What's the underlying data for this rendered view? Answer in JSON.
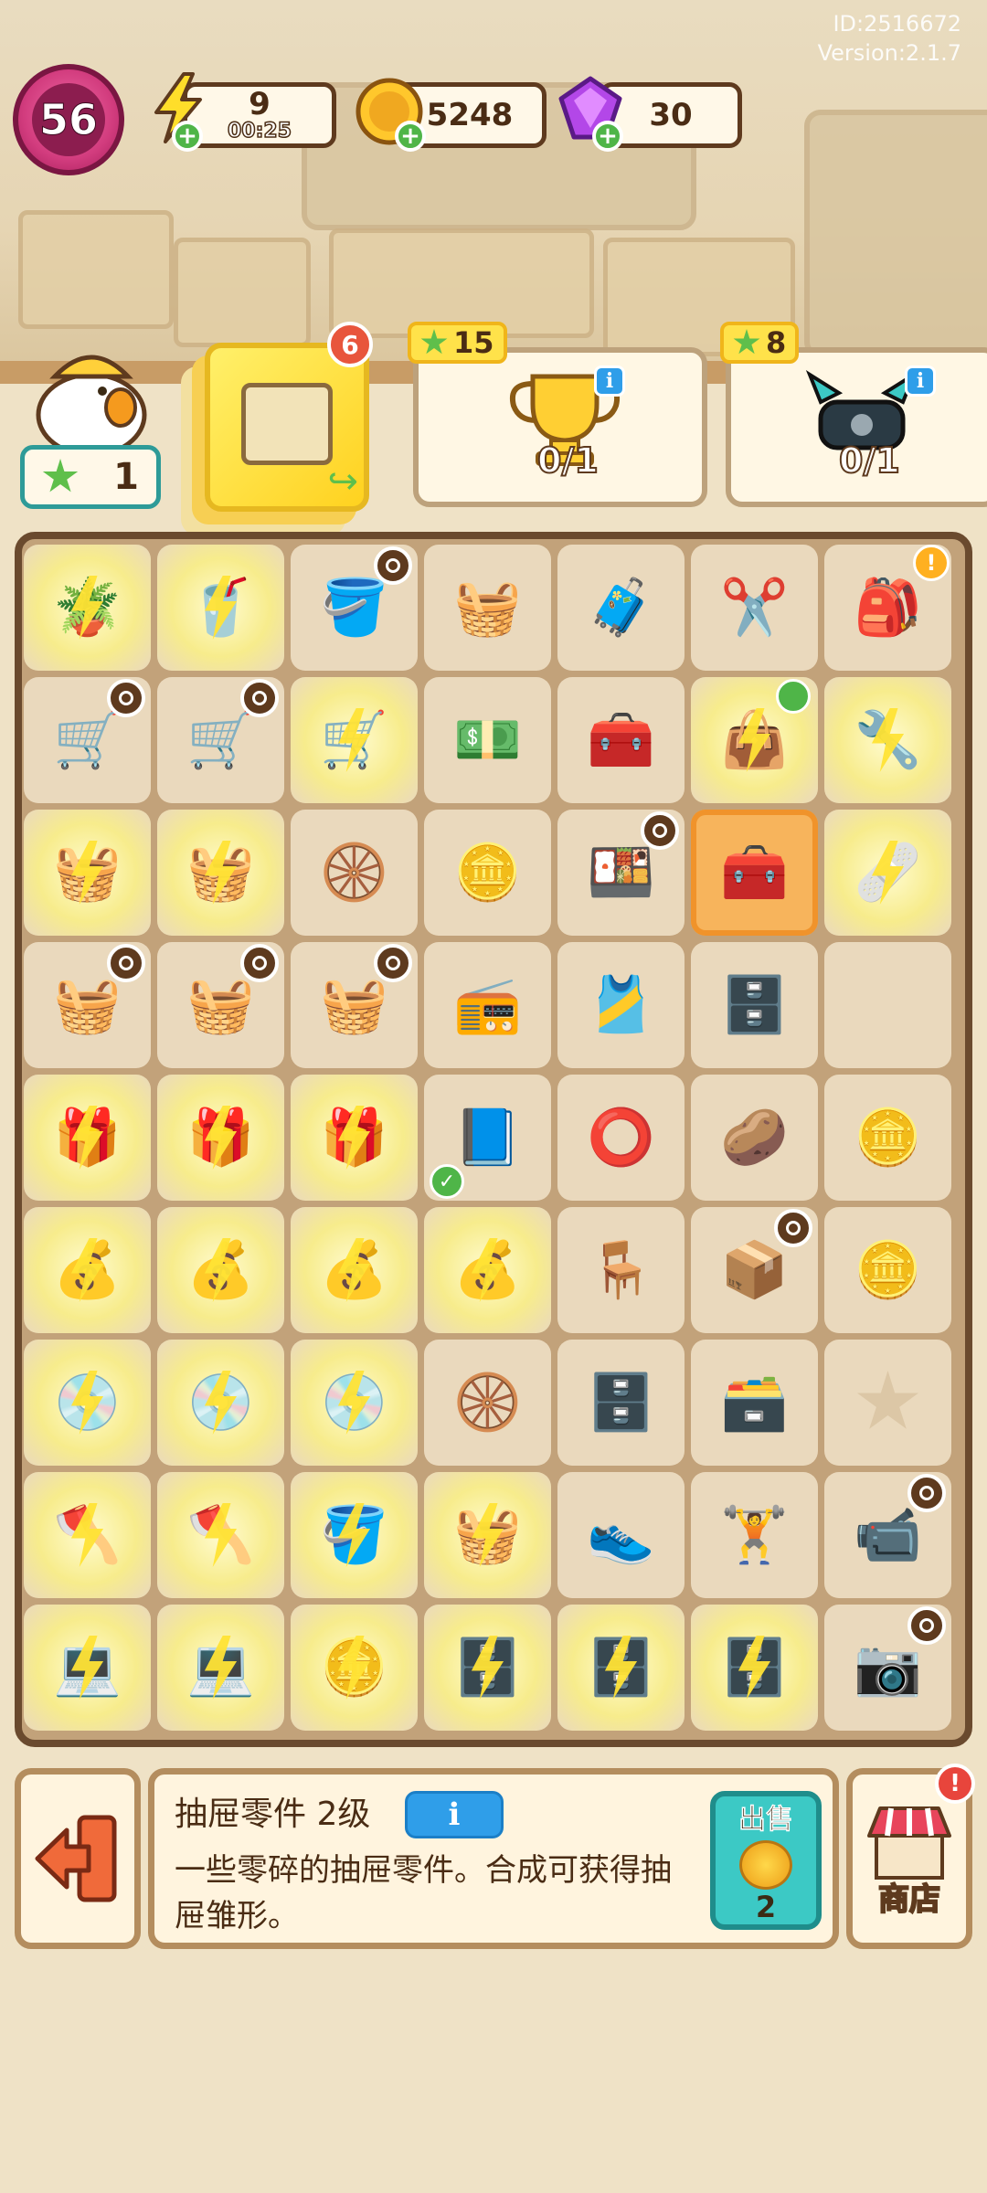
{
  "header": {
    "player_id": "ID:2516672",
    "version": "Version:2.1.7"
  },
  "resources": {
    "level": "56",
    "energy": {
      "value": "9",
      "timer": "00:25"
    },
    "coins": "5248",
    "gems": "30"
  },
  "quests": {
    "duck_stars": "1",
    "active_card_badge": "6",
    "trophy_reward": "15",
    "trophy_progress": "0/1",
    "robot_reward": "8",
    "robot_progress": "0/1"
  },
  "board": {
    "rows": [
      [
        {
          "item": "🪴",
          "glow": true
        },
        {
          "item": "🥤",
          "glow": true
        },
        {
          "item": "🪣",
          "clock": true
        },
        {
          "item": "🧺"
        },
        {
          "item": "🧳"
        },
        {
          "item": "✂️"
        },
        {
          "item": "🎒",
          "alert": true
        }
      ],
      [
        {
          "item": "🛒",
          "clock": true
        },
        {
          "item": "🛒",
          "clock": true
        },
        {
          "item": "🛒",
          "glow": true
        },
        {
          "item": "💵"
        },
        {
          "item": "🧰"
        },
        {
          "item": "👜",
          "glow": true,
          "lock": true
        },
        {
          "item": "🔧",
          "glow": true
        }
      ],
      [
        {
          "item": "🧺",
          "glow": true
        },
        {
          "item": "🧺",
          "glow": true
        },
        {
          "item": "🛞"
        },
        {
          "item": "🪙"
        },
        {
          "item": "🍱",
          "clock": true
        },
        {
          "item": "🧰",
          "sel": true
        },
        {
          "item": "🩹",
          "glow": true
        }
      ],
      [
        {
          "item": "🧺",
          "clock": true
        },
        {
          "item": "🧺",
          "clock": true
        },
        {
          "item": "🧺",
          "clock": true
        },
        {
          "item": "📻"
        },
        {
          "item": "🎽"
        },
        {
          "item": "🗄️"
        },
        {
          "item": ""
        }
      ],
      [
        {
          "item": "🎁",
          "glow": true
        },
        {
          "item": "🎁",
          "glow": true
        },
        {
          "item": "🎁",
          "glow": true
        },
        {
          "item": "📘",
          "check": true
        },
        {
          "item": "⭕"
        },
        {
          "item": "🥔"
        },
        {
          "item": "🪙"
        }
      ],
      [
        {
          "item": "💰",
          "glow": true
        },
        {
          "item": "💰",
          "glow": true
        },
        {
          "item": "💰",
          "glow": true
        },
        {
          "item": "💰",
          "glow": true
        },
        {
          "item": "🪑"
        },
        {
          "item": "📦",
          "clock": true
        },
        {
          "item": "🪙"
        }
      ],
      [
        {
          "item": "💿",
          "glow": true
        },
        {
          "item": "💿",
          "glow": true
        },
        {
          "item": "💿",
          "glow": true
        },
        {
          "item": "🛞"
        },
        {
          "item": "🗄️"
        },
        {
          "item": "🗃️"
        },
        {
          "item": "",
          "star": true
        }
      ],
      [
        {
          "item": "🪓",
          "glow": true
        },
        {
          "item": "🪓",
          "glow": true
        },
        {
          "item": "🪣",
          "glow": true
        },
        {
          "item": "🧺",
          "glow": true
        },
        {
          "item": "👟"
        },
        {
          "item": "🏋️"
        },
        {
          "item": "📹",
          "clock": true
        }
      ],
      [
        {
          "item": "💻",
          "glow": true
        },
        {
          "item": "💻",
          "glow": true
        },
        {
          "item": "🪙",
          "glow": true
        },
        {
          "item": "🗄️",
          "glow": true
        },
        {
          "item": "🗄️",
          "glow": true
        },
        {
          "item": "🗄️",
          "glow": true
        },
        {
          "item": "📷",
          "clock": true
        }
      ]
    ]
  },
  "detail": {
    "name": "抽屉零件 2级",
    "info_label": "i",
    "description": "一些零碎的抽屉零件。合成可获得抽屉雏形。",
    "sell_label": "出售",
    "sell_price": "2"
  },
  "shop": {
    "label": "商店",
    "alert": "!"
  },
  "colors": {
    "accent_green": "#4fb548",
    "info_blue": "#2f9ee9",
    "sell_teal": "#3cc9c5",
    "board_frame": "#6a4a2e"
  }
}
